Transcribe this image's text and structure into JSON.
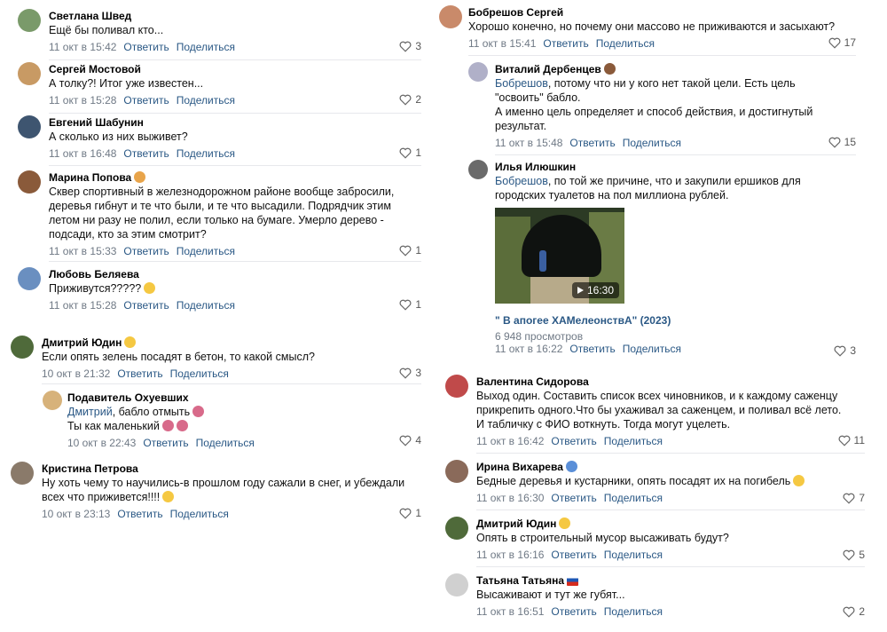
{
  "actions": {
    "reply": "Ответить",
    "share": "Поделиться"
  },
  "left": [
    {
      "author": "Светлана Швед",
      "text": "Ещё бы поливал кто...",
      "time": "11 окт в 15:42",
      "likes": "3",
      "avatar_color": "#7a9a6a"
    },
    {
      "author": "Сергей Мостовой",
      "text": "А толку?! Итог уже известен...",
      "time": "11 окт в 15:28",
      "likes": "2",
      "avatar_color": "#c89a64"
    },
    {
      "author": "Евгений Шабунин",
      "text": "А сколько из них выживет?",
      "time": "11 окт в 16:48",
      "likes": "1",
      "avatar_color": "#3e5570"
    },
    {
      "author": "Марина Попова",
      "text": "Сквер спортивный в железнодорожном районе вообще забросили, деревья гибнут и те что были, и те что высадили. Подрядчик этим летом ни разу не полил, если только на бумаге. Умерло дерево - подсади, кто за этим смотрит?",
      "time": "11 окт в 15:33",
      "likes": "1",
      "avatar_color": "#8a5a3a"
    },
    {
      "author": "Любовь Беляева",
      "text": "Приживутся?????",
      "time": "11 окт в 15:28",
      "likes": "1",
      "avatar_color": "#6a8fc0"
    },
    {
      "author": "Дмитрий Юдин",
      "text": "Если опять зелень посадят в бетон, то какой смысл?",
      "time": "10 окт в 21:32",
      "likes": "3",
      "avatar_color": "#4f6a3a"
    },
    {
      "author": "Подавитель Охуевших",
      "reply_to": "Дмитрий",
      "text_line1": ", бабло отмыть",
      "text_line2": "Ты как маленький",
      "time": "10 окт в 22:43",
      "likes": "4",
      "avatar_color": "#d7b27a"
    },
    {
      "author": "Кристина Петрова",
      "text": "Ну хоть чему то научились-в прошлом году сажали в снег, и убеждали всех что приживется!!!!",
      "time": "10 окт в 23:13",
      "likes": "1",
      "avatar_color": "#8a7a6a"
    }
  ],
  "right": [
    {
      "author": "Бобрешов Сергей",
      "text": "Хорошо конечно, но почему они массово не приживаются и засыхают?",
      "time": "11 окт в 15:41",
      "likes": "17",
      "avatar_color": "#c98a6a"
    },
    {
      "author": "Виталий Дербенцев",
      "reply_to": "Бобрешов",
      "text": ", потому что ни у кого нет такой цели. Есть цель \"освоить\" бабло.",
      "text2": "А именно цель определяет и способ действия, и достигнутый результат.",
      "time": "11 окт в 15:48",
      "likes": "15",
      "avatar_color": "#b0b0c8"
    },
    {
      "author": "Илья Илюшкин",
      "reply_to": "Бобрешов",
      "text": ", по той же причине, что и закупили ершиков для городских туалетов на пол миллиона рублей.",
      "video_duration": "16:30",
      "video_title": "\" В апогее ХАМелеонствА\" (2023)",
      "video_views": "6 948 просмотров",
      "time": "11 окт в 16:22",
      "likes": "3",
      "avatar_color": "#6a6a6a"
    },
    {
      "author": "Валентина Сидорова",
      "text": "Выход один. Составить список всех чиновников, и к каждому саженцу прикрепить одного.Что бы ухаживал за саженцем, и поливал всё лето. И табличку с ФИО воткнуть. Тогда могут уцелеть.",
      "time": "11 окт в 16:42",
      "likes": "11",
      "avatar_color": "#c04a4a"
    },
    {
      "author": "Ирина Вихарева",
      "text": "Бедные деревья и кустарники, опять посадят их на погибель",
      "time": "11 окт в 16:30",
      "likes": "7",
      "avatar_color": "#8a6a5a"
    },
    {
      "author": "Дмитрий Юдин",
      "text": "Опять в строительный мусор высаживать будут?",
      "time": "11 окт в 16:16",
      "likes": "5",
      "avatar_color": "#4f6a3a"
    },
    {
      "author": "Татьяна Татьяна",
      "text": "Высаживают и тут же губят...",
      "time": "11 окт в 16:51",
      "likes": "2",
      "avatar_color": "#d0d0d0"
    }
  ]
}
